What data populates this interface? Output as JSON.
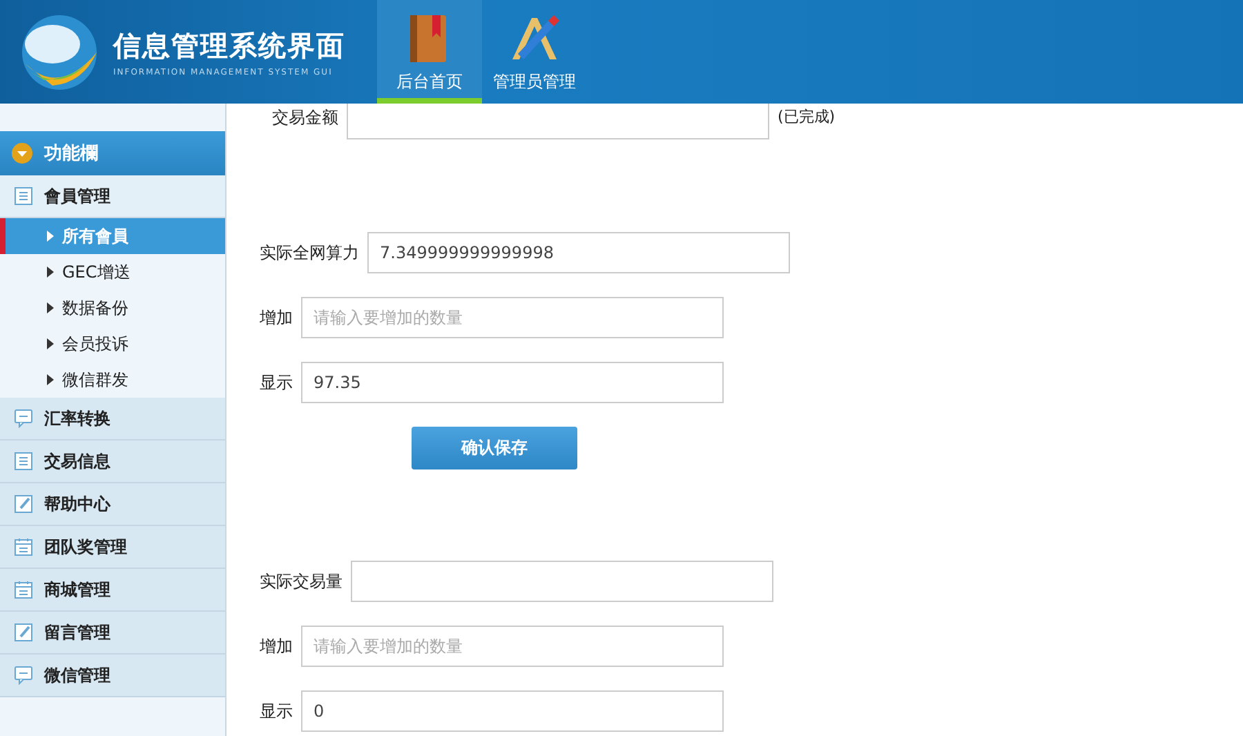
{
  "header": {
    "title": "信息管理系统界面",
    "subtitle": "INFORMATION MANAGEMENT SYSTEM GUI",
    "tabs": [
      {
        "label": "后台首页",
        "kind": "book",
        "selected": true
      },
      {
        "label": "管理员管理",
        "kind": "tools",
        "selected": false
      }
    ]
  },
  "sidebar": {
    "title": "功能欄",
    "groups": [
      {
        "label": "會員管理",
        "kind": "list",
        "expanded": true,
        "children": [
          {
            "label": "所有會員",
            "selected": true
          },
          {
            "label": "GEC增送",
            "selected": false
          },
          {
            "label": "数据备份",
            "selected": false
          },
          {
            "label": "会员投诉",
            "selected": false
          },
          {
            "label": "微信群发",
            "selected": false
          }
        ]
      },
      {
        "label": "汇率转换",
        "kind": "chat",
        "expanded": false
      },
      {
        "label": "交易信息",
        "kind": "list",
        "expanded": false
      },
      {
        "label": "帮助中心",
        "kind": "edit",
        "expanded": false
      },
      {
        "label": "团队奖管理",
        "kind": "calendar",
        "expanded": false
      },
      {
        "label": "商城管理",
        "kind": "calendar",
        "expanded": false
      },
      {
        "label": "留言管理",
        "kind": "edit",
        "expanded": false
      },
      {
        "label": "微信管理",
        "kind": "chat",
        "expanded": false
      }
    ]
  },
  "sections": [
    {
      "fields": [
        {
          "label": "交易金额",
          "note": "(已完成)"
        }
      ]
    },
    {
      "fields": [
        {
          "label": "实际全网算力",
          "value": "7.349999999999998"
        },
        {
          "label": "增加",
          "placeholder": "请输入要增加的数量"
        },
        {
          "label": "显示",
          "value": "97.35"
        }
      ],
      "button": "确认保存"
    },
    {
      "fields": [
        {
          "label": "实际交易量"
        },
        {
          "label": "增加",
          "placeholder": "请输入要增加的数量"
        },
        {
          "label": "显示",
          "value": "0"
        }
      ]
    }
  ]
}
